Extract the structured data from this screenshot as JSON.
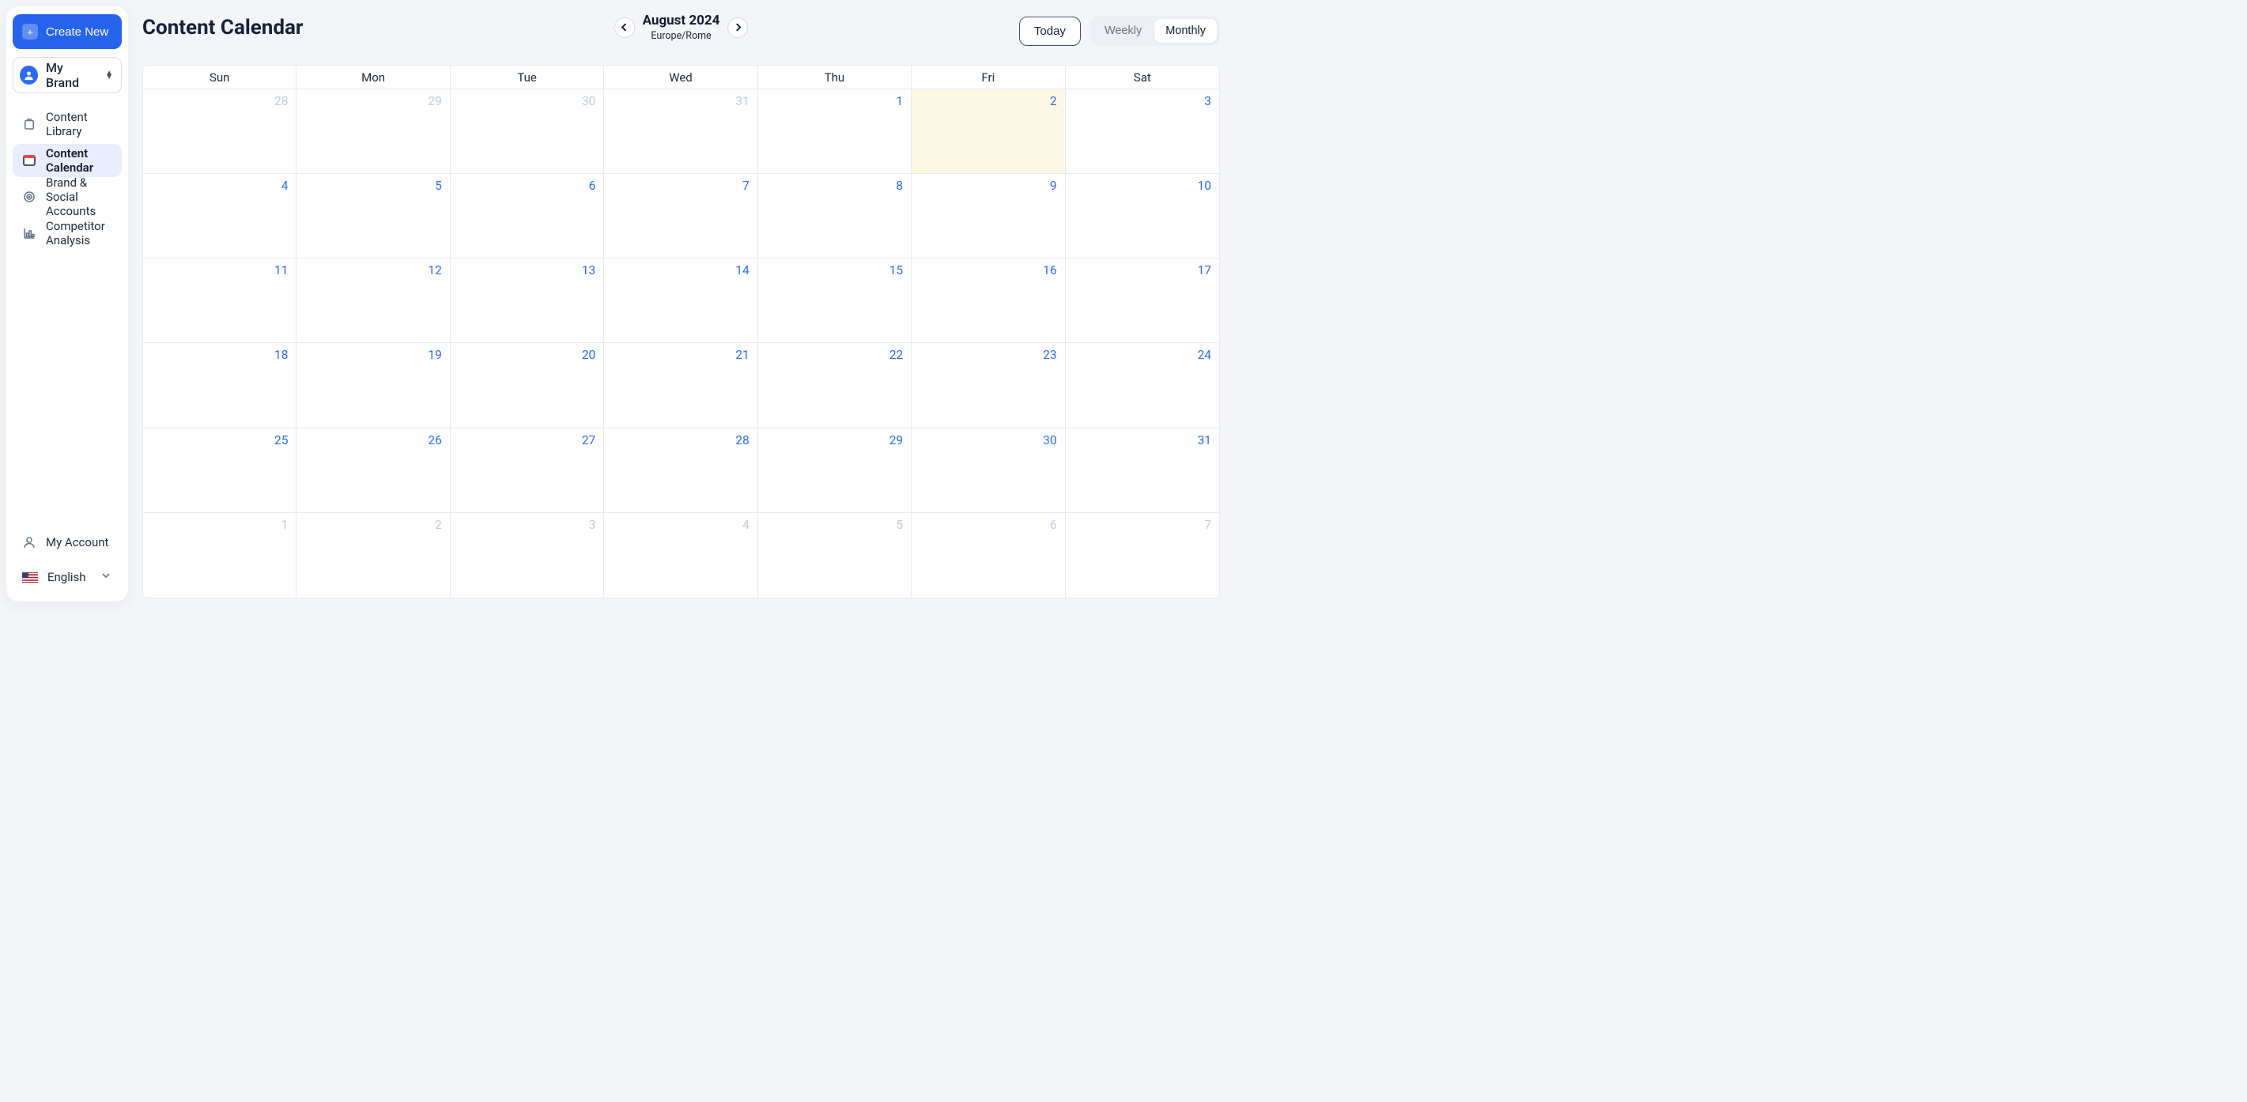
{
  "sidebar": {
    "create_label": "Create New",
    "brand_label": "My Brand",
    "nav": [
      {
        "label": "Content Library"
      },
      {
        "label": "Content Calendar"
      },
      {
        "label": "Brand & Social Accounts"
      },
      {
        "label": "Competitor Analysis"
      }
    ],
    "footer": {
      "account_label": "My Account",
      "language_label": "English"
    }
  },
  "header": {
    "title": "Content Calendar",
    "month": "August 2024",
    "timezone": "Europe/Rome",
    "today_label": "Today",
    "view_weekly": "Weekly",
    "view_monthly": "Monthly"
  },
  "calendar": {
    "days_of_week": [
      "Sun",
      "Mon",
      "Tue",
      "Wed",
      "Thu",
      "Fri",
      "Sat"
    ],
    "cells": [
      {
        "d": "28",
        "other": true
      },
      {
        "d": "29",
        "other": true
      },
      {
        "d": "30",
        "other": true
      },
      {
        "d": "31",
        "other": true
      },
      {
        "d": "1"
      },
      {
        "d": "2",
        "today": true
      },
      {
        "d": "3"
      },
      {
        "d": "4"
      },
      {
        "d": "5"
      },
      {
        "d": "6"
      },
      {
        "d": "7"
      },
      {
        "d": "8"
      },
      {
        "d": "9"
      },
      {
        "d": "10"
      },
      {
        "d": "11"
      },
      {
        "d": "12"
      },
      {
        "d": "13"
      },
      {
        "d": "14"
      },
      {
        "d": "15"
      },
      {
        "d": "16"
      },
      {
        "d": "17"
      },
      {
        "d": "18"
      },
      {
        "d": "19"
      },
      {
        "d": "20"
      },
      {
        "d": "21"
      },
      {
        "d": "22"
      },
      {
        "d": "23"
      },
      {
        "d": "24"
      },
      {
        "d": "25"
      },
      {
        "d": "26"
      },
      {
        "d": "27"
      },
      {
        "d": "28"
      },
      {
        "d": "29"
      },
      {
        "d": "30"
      },
      {
        "d": "31"
      },
      {
        "d": "1",
        "other": true
      },
      {
        "d": "2",
        "other": true
      },
      {
        "d": "3",
        "other": true
      },
      {
        "d": "4",
        "other": true
      },
      {
        "d": "5",
        "other": true
      },
      {
        "d": "6",
        "other": true
      },
      {
        "d": "7",
        "other": true
      }
    ]
  }
}
